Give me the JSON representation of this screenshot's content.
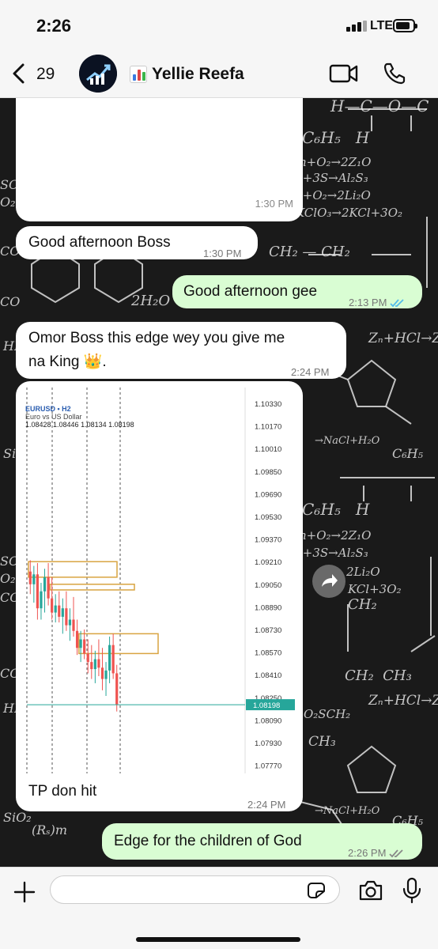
{
  "status_bar": {
    "time": "2:26",
    "network": "LTE"
  },
  "header": {
    "back_count": "29",
    "contact_name": "Yellie Reefa",
    "name_emoji": "bar-chart-emoji"
  },
  "messages": [
    {
      "time": "1:30 PM"
    },
    {
      "text": "Good afternoon Boss",
      "time": "1:30 PM"
    },
    {
      "text": "Good afternoon gee",
      "time": "2:13 PM"
    },
    {
      "line1": "Omor Boss this edge wey you give me",
      "line2": "na King 👑.",
      "time": "2:24 PM"
    },
    {
      "caption": "TP don hit",
      "time": "2:24 PM"
    },
    {
      "text": "Edge for the children of God",
      "time": "2:26 PM"
    }
  ],
  "chart_data": {
    "type": "candlestick",
    "title": "EURUSD • H2",
    "subtitle": "Euro vs US Dollar",
    "ohlc": "1.08428 1.08446 1.08134 1.08198",
    "y_ticks": [
      "1.10330",
      "1.10170",
      "1.10010",
      "1.09850",
      "1.09690",
      "1.09530",
      "1.09370",
      "1.09210",
      "1.09050",
      "1.08890",
      "1.08730",
      "1.08570",
      "1.08410",
      "1.08250",
      "1.08090",
      "1.07930",
      "1.07770"
    ],
    "current_price": "1.08198",
    "candles": [
      [
        1.0914,
        1.0922,
        1.0898,
        1.0905
      ],
      [
        1.0905,
        1.0918,
        1.0892,
        1.0912
      ],
      [
        1.0912,
        1.092,
        1.088,
        1.0888
      ],
      [
        1.0888,
        1.0906,
        1.088,
        1.09
      ],
      [
        1.09,
        1.0916,
        1.0885,
        1.091
      ],
      [
        1.091,
        1.092,
        1.089,
        1.0895
      ],
      [
        1.0895,
        1.091,
        1.088,
        1.0885
      ],
      [
        1.0885,
        1.0898,
        1.0878,
        1.089
      ],
      [
        1.089,
        1.09,
        1.0878,
        1.0882
      ],
      [
        1.0882,
        1.0895,
        1.087,
        1.0888
      ],
      [
        1.0888,
        1.09,
        1.0872,
        1.0876
      ],
      [
        1.0876,
        1.0888,
        1.0865,
        1.088
      ],
      [
        1.088,
        1.0896,
        1.0868,
        1.0872
      ],
      [
        1.0872,
        1.088,
        1.0855,
        1.086
      ],
      [
        1.086,
        1.0872,
        1.085,
        1.0866
      ],
      [
        1.0866,
        1.0873,
        1.0852,
        1.0856
      ],
      [
        1.0856,
        1.0866,
        1.0842,
        1.085
      ],
      [
        1.085,
        1.0862,
        1.0838,
        1.0845
      ],
      [
        1.0845,
        1.0858,
        1.0835,
        1.0852
      ],
      [
        1.0852,
        1.0866,
        1.084,
        1.0846
      ],
      [
        1.0846,
        1.086,
        1.083,
        1.0838
      ],
      [
        1.0838,
        1.085,
        1.0826,
        1.0844
      ],
      [
        1.0844,
        1.0868,
        1.0835,
        1.0862
      ],
      [
        1.0862,
        1.087,
        1.0838,
        1.0842
      ],
      [
        1.0842,
        1.0848,
        1.0815,
        1.082
      ]
    ],
    "zones": [
      {
        "from": 1.0921,
        "to": 1.091,
        "start_bar": 0,
        "end_bar": 24
      },
      {
        "from": 1.0905,
        "to": 1.0901,
        "start_bar": 6,
        "end_bar": 24
      },
      {
        "from": 1.087,
        "to": 1.0856,
        "start_bar": 14,
        "end_bar": 24
      }
    ],
    "colors": {
      "bull": "#26a69a",
      "bear": "#ef5350",
      "zone": "#d9a441",
      "price_line": "#26a69a"
    }
  },
  "input": {
    "placeholder": ""
  },
  "colors": {
    "incoming": "#ffffff",
    "outgoing": "#d9fdd3",
    "read_ticks": "#53bdeb",
    "chat_bg": "#1a1a1a"
  }
}
